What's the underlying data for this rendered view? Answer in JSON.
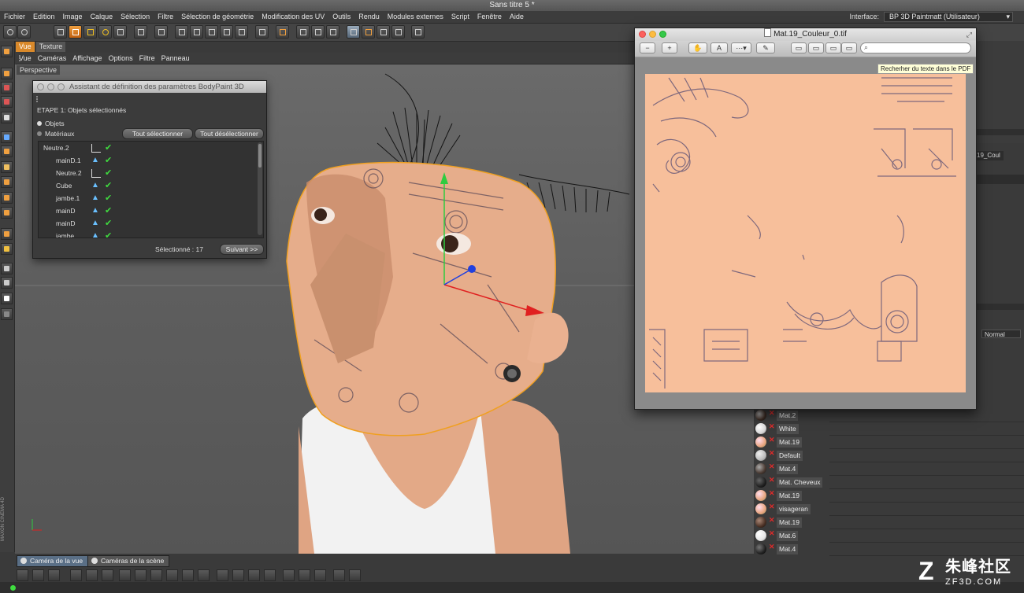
{
  "window": {
    "title": "Sans titre 5 *"
  },
  "menubar": {
    "items": [
      "Fichier",
      "Edition",
      "Image",
      "Calque",
      "Sélection",
      "Filtre",
      "Sélection de géométrie",
      "Modification des UV",
      "Outils",
      "Rendu",
      "Modules externes",
      "Script",
      "Fenêtre",
      "Aide"
    ]
  },
  "interface": {
    "label": "Interface:",
    "value": "BP 3D Paintmatt (Utilisateur)"
  },
  "viewtabs": [
    "Vue",
    "Texture"
  ],
  "viewmenu": [
    "Vue",
    "Caméras",
    "Affichage",
    "Options",
    "Filtre",
    "Panneau"
  ],
  "viewport": {
    "label": "Perspective"
  },
  "assistant": {
    "title": "Assistant de définition des paramètres BodyPaint 3D",
    "step": "ETAPE 1: Objets sélectionnés",
    "options": [
      "Objets",
      "Matériaux"
    ],
    "select_all": "Tout sélectionner",
    "deselect_all": "Tout désélectionner",
    "objects": [
      {
        "name": "Neutre.2",
        "icon": "null-object-icon"
      },
      {
        "name": "mainD.1",
        "icon": "polygon-object-icon"
      },
      {
        "name": "Neutre.2",
        "icon": "null-object-icon"
      },
      {
        "name": "Cube",
        "icon": "polygon-object-icon"
      },
      {
        "name": "jambe.1",
        "icon": "polygon-object-icon"
      },
      {
        "name": "mainD",
        "icon": "polygon-object-icon"
      },
      {
        "name": "mainD",
        "icon": "polygon-object-icon"
      },
      {
        "name": "jambe",
        "icon": "polygon-object-icon"
      }
    ],
    "selected_label": "Sélectionné :",
    "selected_count": "17",
    "next": "Suivant >>"
  },
  "preview": {
    "title": "Mat.19_Couleur_0.tif",
    "tooltip": "Recherher du texte dans le PDF",
    "texture_color": "#f7bf9b"
  },
  "right": {
    "blend_mode": "Normal",
    "channel": "19_Coul"
  },
  "materials": [
    {
      "name": "Mat.2",
      "color": "#3a2a22"
    },
    {
      "name": "White",
      "color": "#d8d8d8"
    },
    {
      "name": "Mat.19",
      "color": "#e9a57f"
    },
    {
      "name": "Default",
      "color": "#bdbdbd"
    },
    {
      "name": "Mat.4",
      "color": "#4a3a32"
    },
    {
      "name": "Mat. Cheveux",
      "color": "#202020"
    },
    {
      "name": "Mat.19",
      "color": "#e9a57f"
    },
    {
      "name": "visageran",
      "color": "#e9a57f"
    },
    {
      "name": "Mat.19",
      "color": "#4a3024"
    },
    {
      "name": "Mat.6",
      "color": "#e6e6e6"
    },
    {
      "name": "Mat.4",
      "color": "#222222"
    }
  ],
  "camera_tabs": [
    "Caméra de la vue",
    "Caméras de la scène"
  ],
  "branding": {
    "vendor": "MAXON CINEMA 4D"
  },
  "watermark": {
    "logo": "Z",
    "cn": "朱峰社区",
    "en": "ZF3D.COM"
  }
}
